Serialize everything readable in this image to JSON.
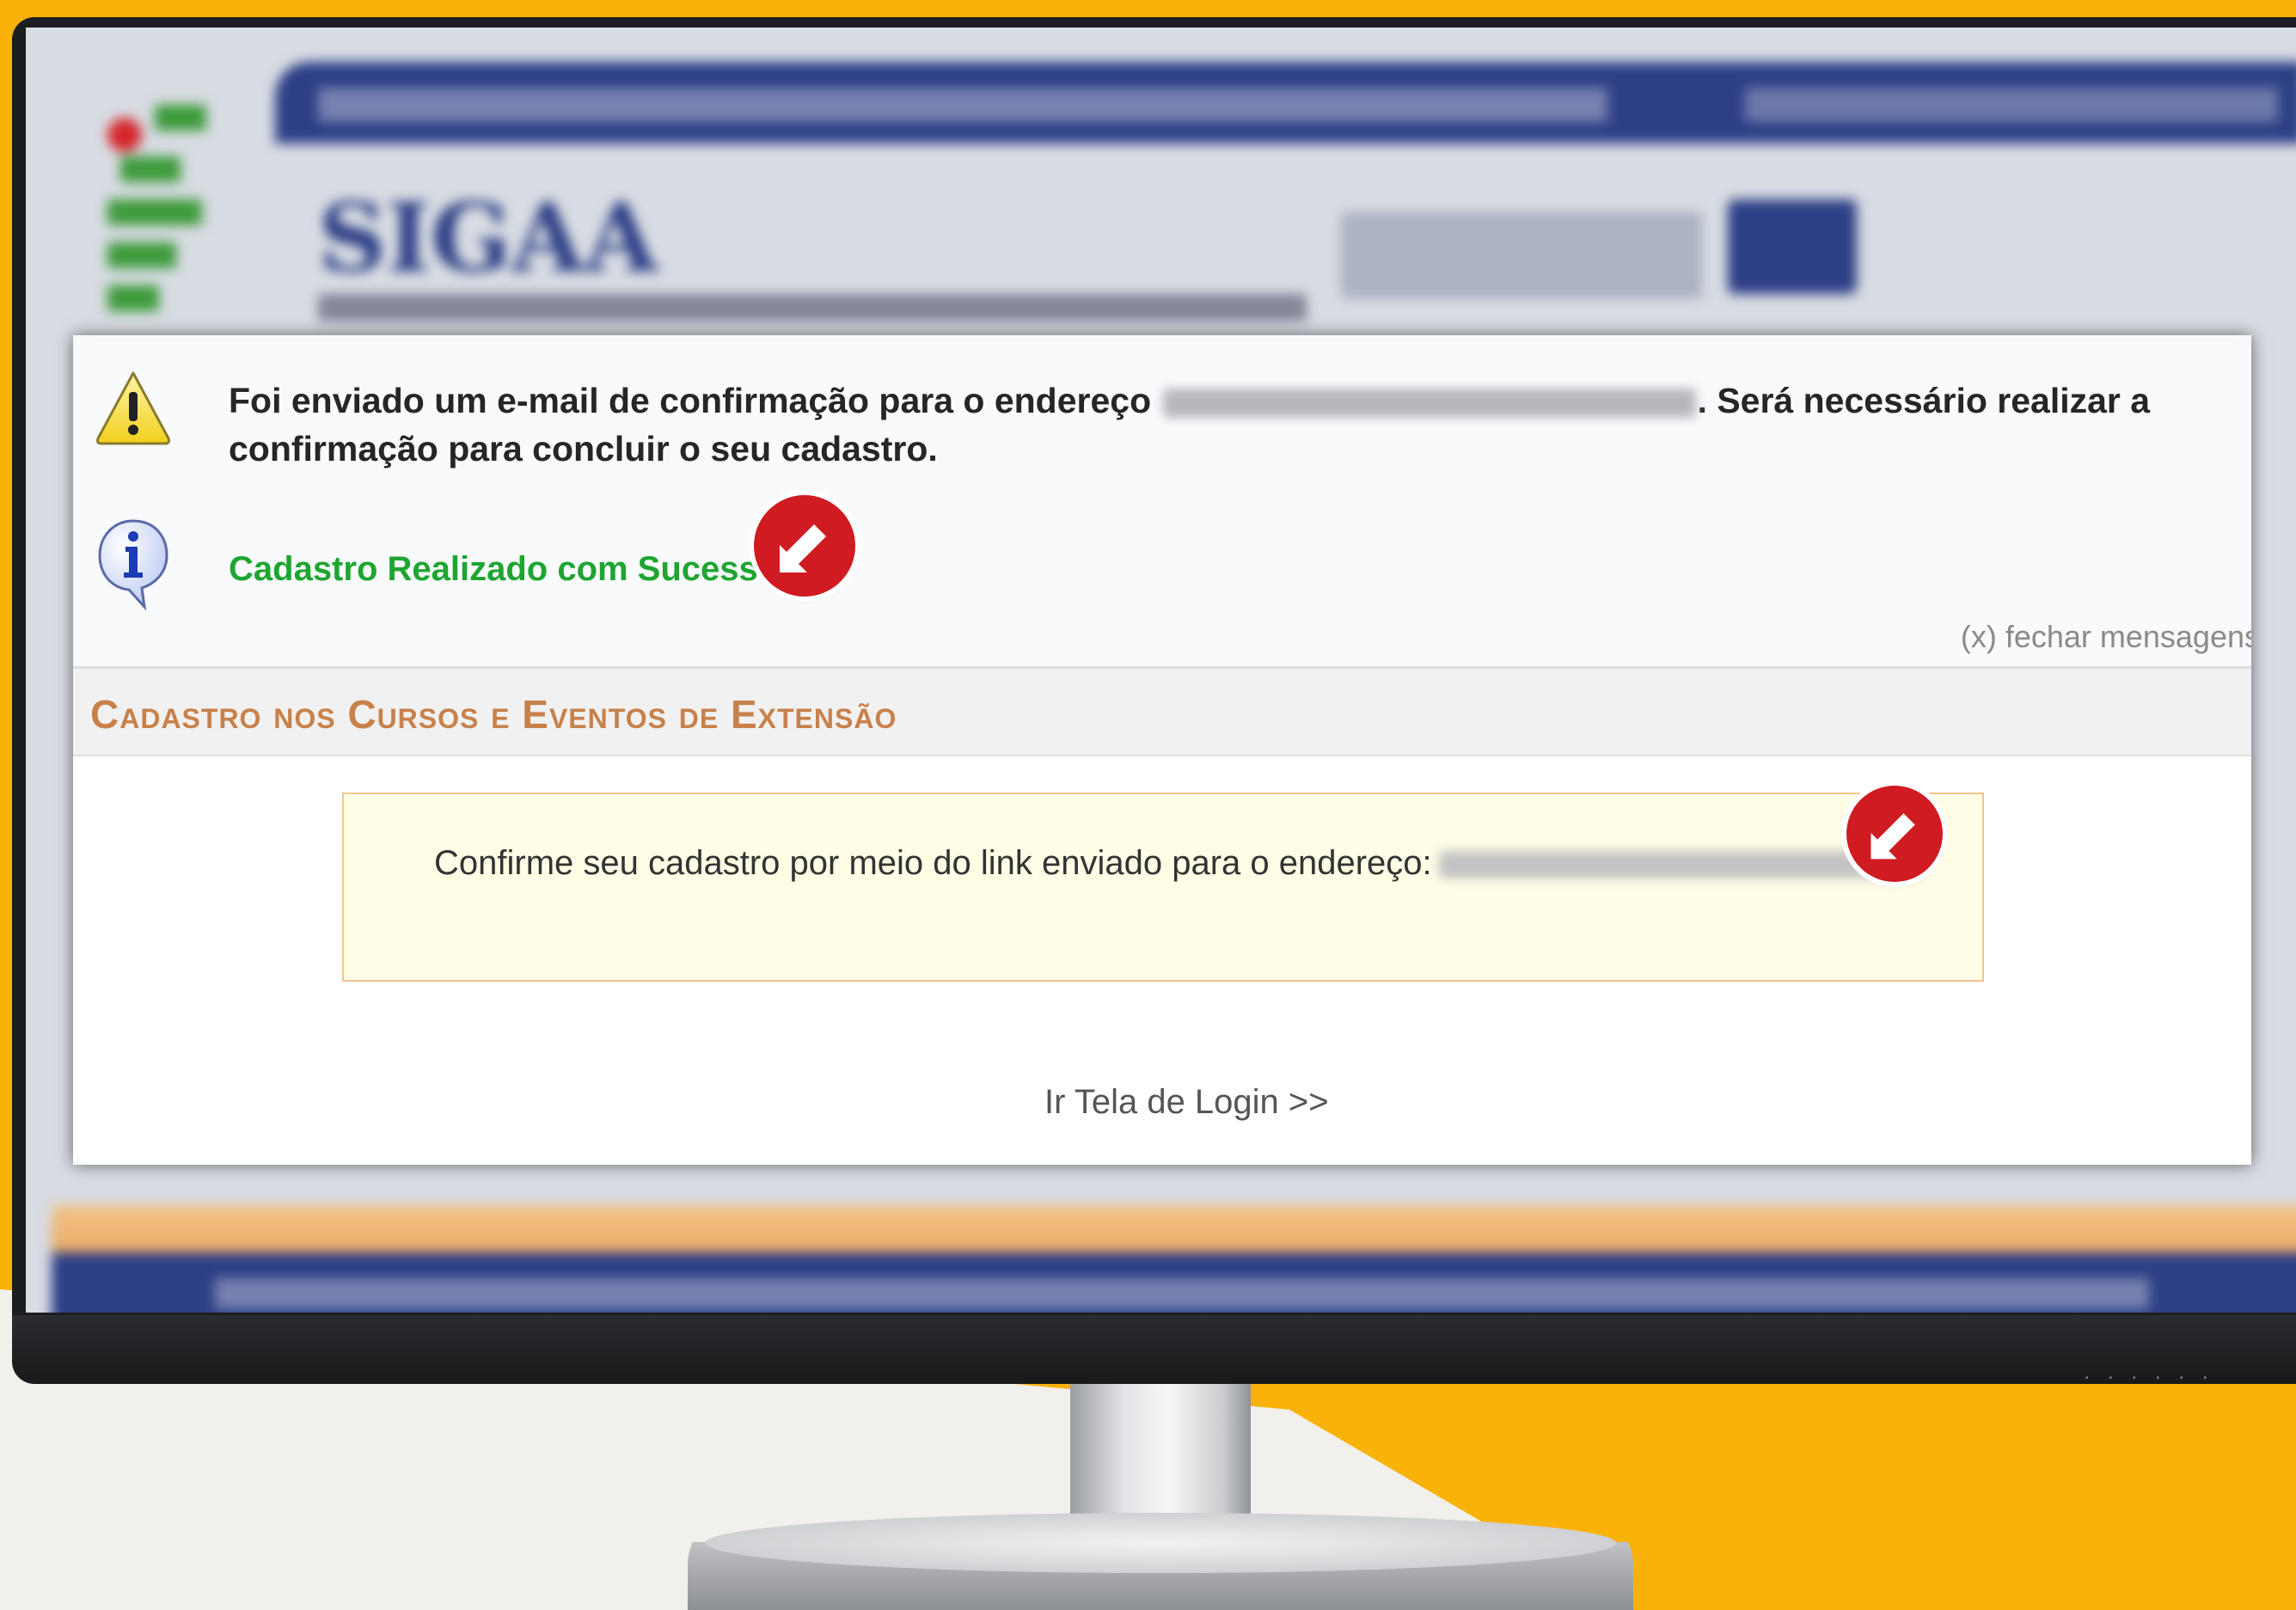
{
  "messages": {
    "warning_prefix": "Foi enviado um e-mail de confirmação para o endereço",
    "warning_suffix": ". Será necessário realizar a confirmação para concluir o seu cadastro.",
    "success": "Cadastro Realizado com Sucesso!",
    "close_label": "(x) fechar mensagens"
  },
  "section": {
    "title": "Cadastro nos Cursos e Eventos de Extensão"
  },
  "notice": {
    "text": "Confirme seu cadastro por meio do link enviado para o endereço:"
  },
  "login_link": "Ir Tela de Login >>",
  "blurred_header": {
    "brand": "SIGAA"
  },
  "colors": {
    "accent_red": "#cf1b21",
    "success_green": "#1ea531",
    "section_title": "#c8814a",
    "header_blue": "#2d3f86",
    "background_yellow": "#f9b20a"
  }
}
